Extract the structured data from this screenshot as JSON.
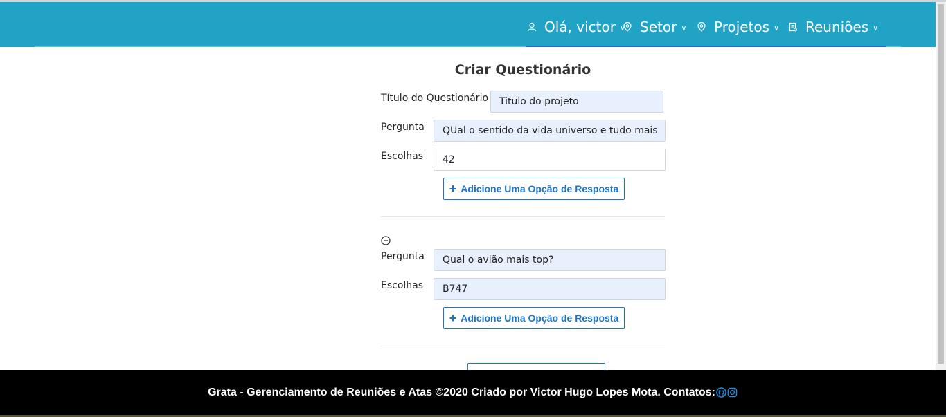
{
  "nav": {
    "user_greeting": "Olá, victor",
    "setor": "Setor",
    "projetos": "Projetos",
    "reunioes": "Reuniões",
    "icons": [
      "user-icon",
      "location-pin-icon",
      "location-pin-icon",
      "document-icon",
      "chevron-down-icon"
    ]
  },
  "form": {
    "title": "Criar Questionário",
    "questionnaire_title_label": "Título do Questionário",
    "questionnaire_title_value": "Titulo do projeto",
    "add_option_label": "Adicione Uma Opção de Resposta",
    "questions": [
      {
        "question_label": "Pergunta",
        "question_value": "QUal o sentido da vida universo e tudo mais",
        "choices_label": "Escolhas",
        "choices_value": "42"
      },
      {
        "question_label": "Pergunta",
        "question_value": "Qual o avião mais top?",
        "choices_label": "Escolhas",
        "choices_value": "B747"
      }
    ]
  },
  "footer": {
    "text": "Grata - Gerenciamento de Reuniões e Atas ©2020 Criado por Victor Hugo Lopes Mota. Contatos:",
    "icons": [
      "github-icon",
      "instagram-icon"
    ]
  },
  "colors": {
    "navbar": "#20a3c4",
    "accent": "#1a73c8",
    "input_filled": "#e8f0fe",
    "footer": "#000000"
  }
}
